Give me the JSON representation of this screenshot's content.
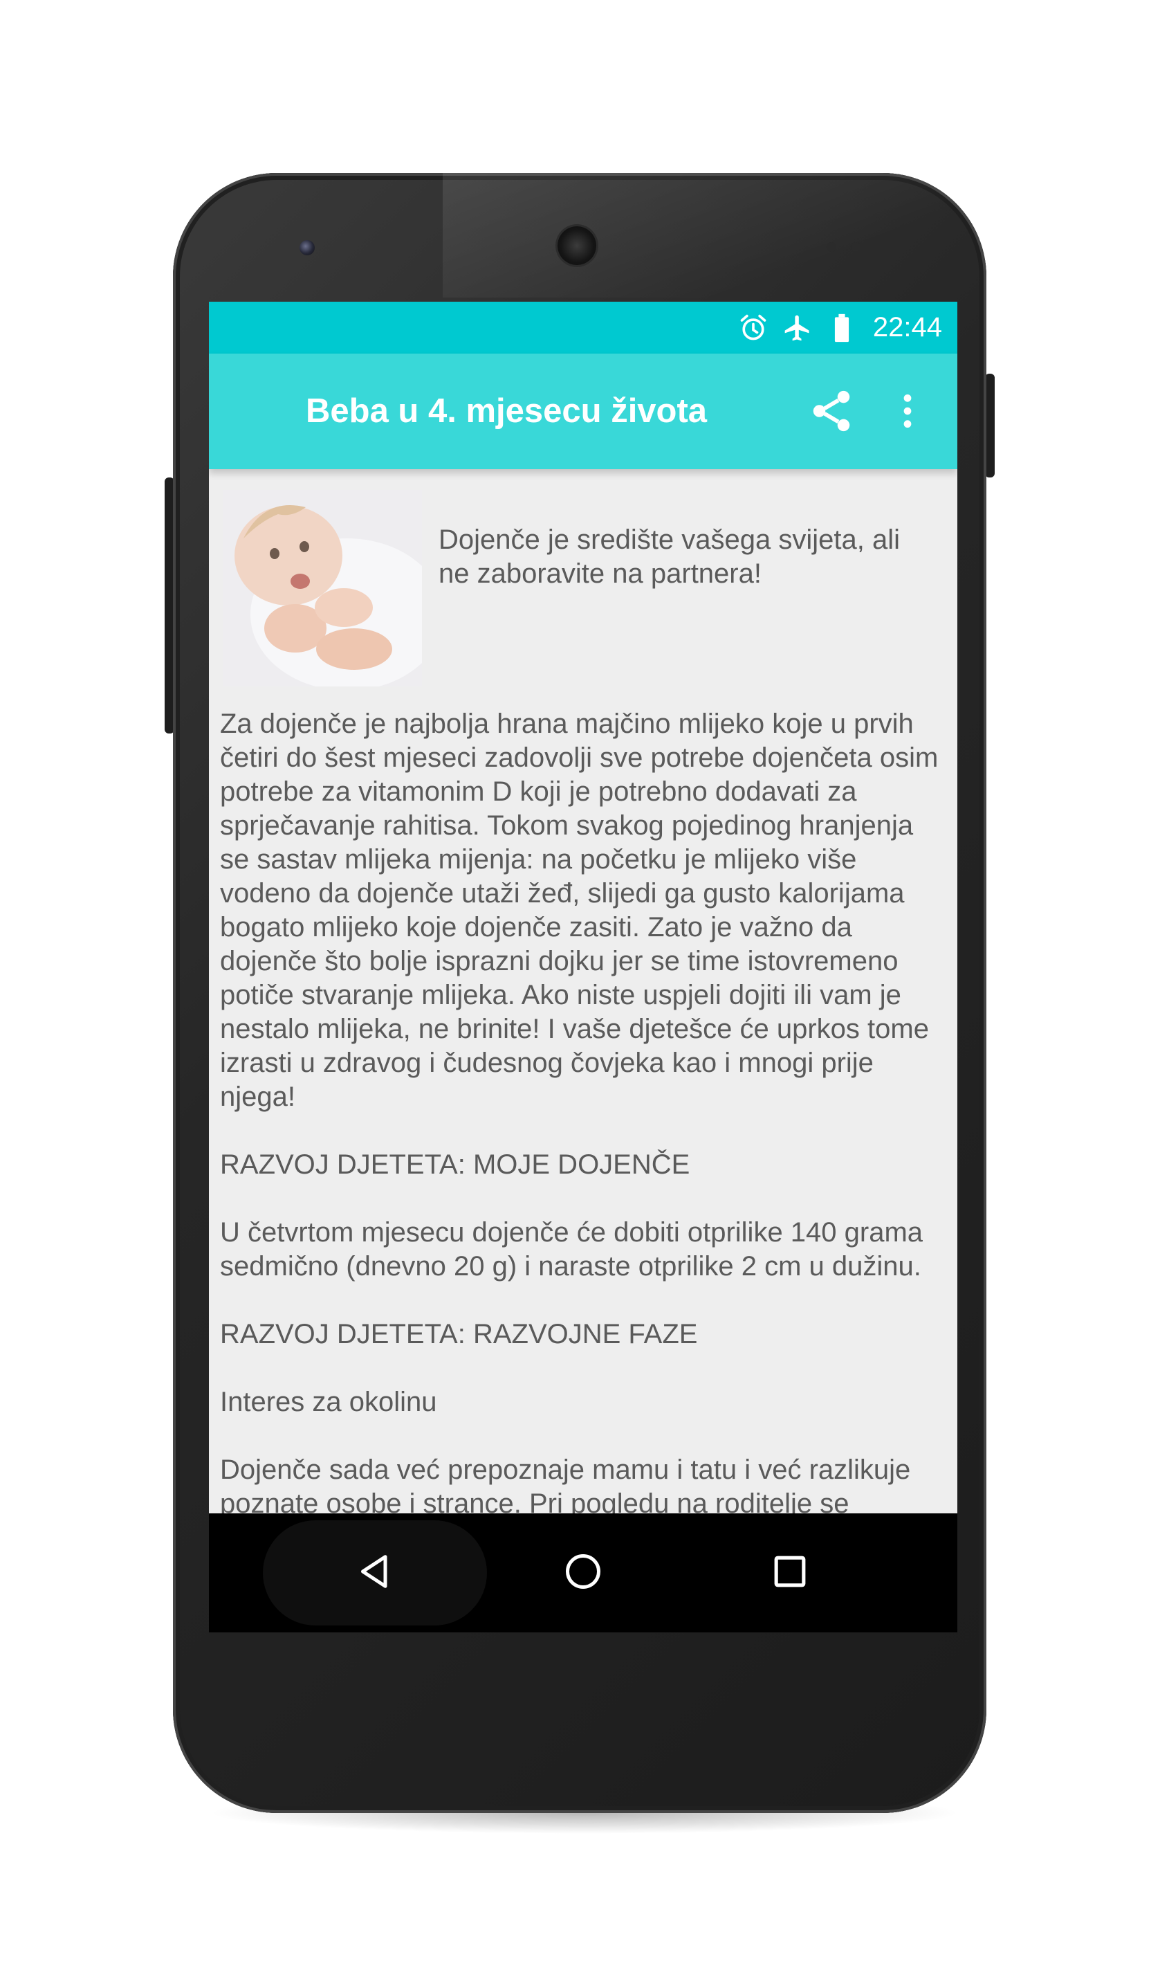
{
  "status_bar": {
    "time": "22:44",
    "icons": [
      "alarm-icon",
      "airplane-icon",
      "battery-icon"
    ],
    "color": "#00c9d0"
  },
  "app_bar": {
    "title": "Beba u 4. mjesecu života",
    "color": "#39d8d8",
    "actions": [
      "share-icon",
      "overflow-menu-icon"
    ]
  },
  "article": {
    "image": "baby-photo",
    "intro": "Dojenče je središte vašega svijeta, ali ne zaboravite na partnera!",
    "paragraphs": [
      "Za dojenče je najbolja hrana majčino mlijeko koje u prvih četiri do šest mjeseci zadovolji sve potrebe dojenčeta osim potrebe za vitamonim D koji je potrebno dodavati za sprječavanje rahitisa. Tokom svakog pojedinog hranjenja se sastav mlijeka mijenja: na početku je mlijeko više vodeno da dojenče utaži žeđ, slijedi ga gusto kalorijama bogato mlijeko koje dojenče zasiti. Zato je važno da dojenče što bolje isprazni dojku jer se time istovremeno potiče stvaranje mlijeka. Ako niste uspjeli dojiti ili vam je nestalo mlijeka, ne brinite! I vaše djetešce će uprkos tome izrasti u zdravog i čudesnog čovjeka kao i mnogi prije njega!",
      "RAZVOJ DJETETA: MOJE DOJENČE",
      "U četvrtom mjesecu dojenče će dobiti otprilike 140 grama sedmično (dnevno 20 g) i naraste otprilike 2 cm u dužinu.",
      "RAZVOJ DJETETA: RAZVOJNE FAZE",
      "Interes za okolinu",
      "Dojenče sada već prepoznaje mamu i tatu i već razlikuje poznate osobe i strance. Pri pogledu na roditelje se"
    ]
  },
  "nav_bar": {
    "buttons": [
      "back-icon",
      "home-icon",
      "recents-icon"
    ]
  }
}
